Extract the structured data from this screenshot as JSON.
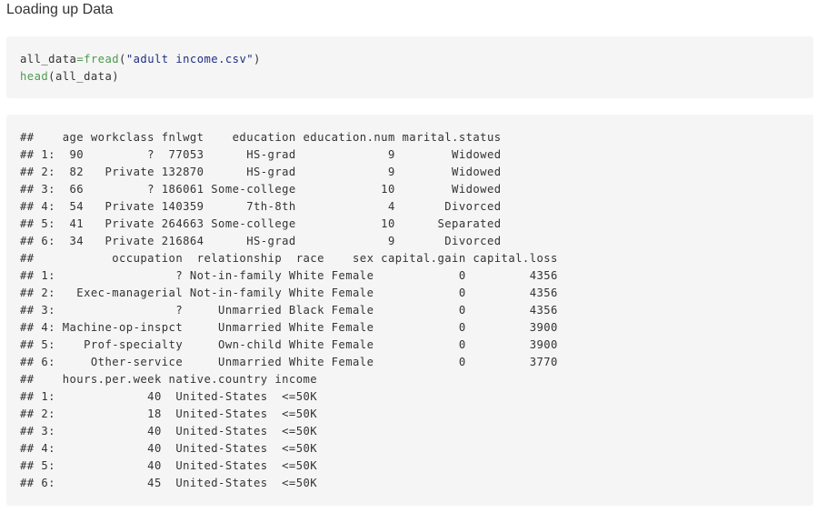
{
  "section_title": "Loading up Data",
  "code": {
    "line1": {
      "var": "all_data",
      "op": "=",
      "fn": "fread",
      "open": "(",
      "str": "\"adult income.csv\"",
      "close": ")"
    },
    "line2": {
      "fn": "head",
      "args": "(all_data)"
    }
  },
  "output_lines": [
    "##    age workclass fnlwgt    education education.num marital.status",
    "## 1:  90         ?  77053      HS-grad             9        Widowed",
    "## 2:  82   Private 132870      HS-grad             9        Widowed",
    "## 3:  66         ? 186061 Some-college            10        Widowed",
    "## 4:  54   Private 140359      7th-8th             4       Divorced",
    "## 5:  41   Private 264663 Some-college            10      Separated",
    "## 6:  34   Private 216864      HS-grad             9       Divorced",
    "##           occupation  relationship  race    sex capital.gain capital.loss",
    "## 1:                 ? Not-in-family White Female            0         4356",
    "## 2:   Exec-managerial Not-in-family White Female            0         4356",
    "## 3:                 ?     Unmarried Black Female            0         4356",
    "## 4: Machine-op-inspct     Unmarried White Female            0         3900",
    "## 5:    Prof-specialty     Own-child White Female            0         3900",
    "## 6:     Other-service     Unmarried White Female            0         3770",
    "##    hours.per.week native.country income",
    "## 1:             40  United-States  <=50K",
    "## 2:             18  United-States  <=50K",
    "## 3:             40  United-States  <=50K",
    "## 4:             40  United-States  <=50K",
    "## 5:             40  United-States  <=50K",
    "## 6:             45  United-States  <=50K"
  ]
}
